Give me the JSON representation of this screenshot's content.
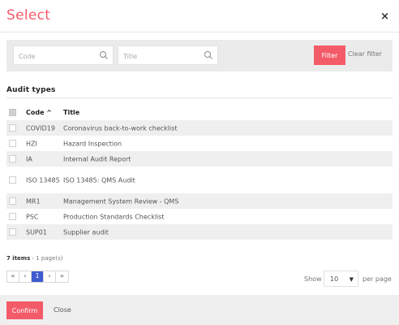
{
  "dialog": {
    "title": "Select",
    "close_icon": "×"
  },
  "filter": {
    "code_placeholder": "Code",
    "title_placeholder": "Title",
    "filter_label": "Filter",
    "clear_label": "Clear filter"
  },
  "section": {
    "title": "Audit types"
  },
  "table": {
    "headers": {
      "code": "Code ^",
      "title": "Title"
    },
    "rows": [
      {
        "code": "COVID19",
        "title": "Coronavirus back-to-work checklist"
      },
      {
        "code": "HZI",
        "title": "Hazard Inspection"
      },
      {
        "code": "IA",
        "title": "Internal Audit Report"
      },
      {
        "code": "ISO 13485",
        "title": "ISO 13485: QMS Audit"
      },
      {
        "code": "MR1",
        "title": "Management System Review - QMS"
      },
      {
        "code": "PSC",
        "title": "Production Standards Checklist"
      },
      {
        "code": "SUP01",
        "title": "Supplier audit"
      }
    ]
  },
  "pagination": {
    "items_count": "7 items",
    "pages_text": " - 1 page(s)",
    "first": "«",
    "prev": "‹",
    "current": "1",
    "next": "›",
    "last": "»",
    "show_label": "Show",
    "page_size": "10",
    "per_page_label": "per page"
  },
  "footer": {
    "confirm_label": "Confirm",
    "close_label": "Close"
  },
  "colors": {
    "accent": "#f45b69",
    "page_active": "#3f5bd0",
    "band": "#ebebeb"
  }
}
